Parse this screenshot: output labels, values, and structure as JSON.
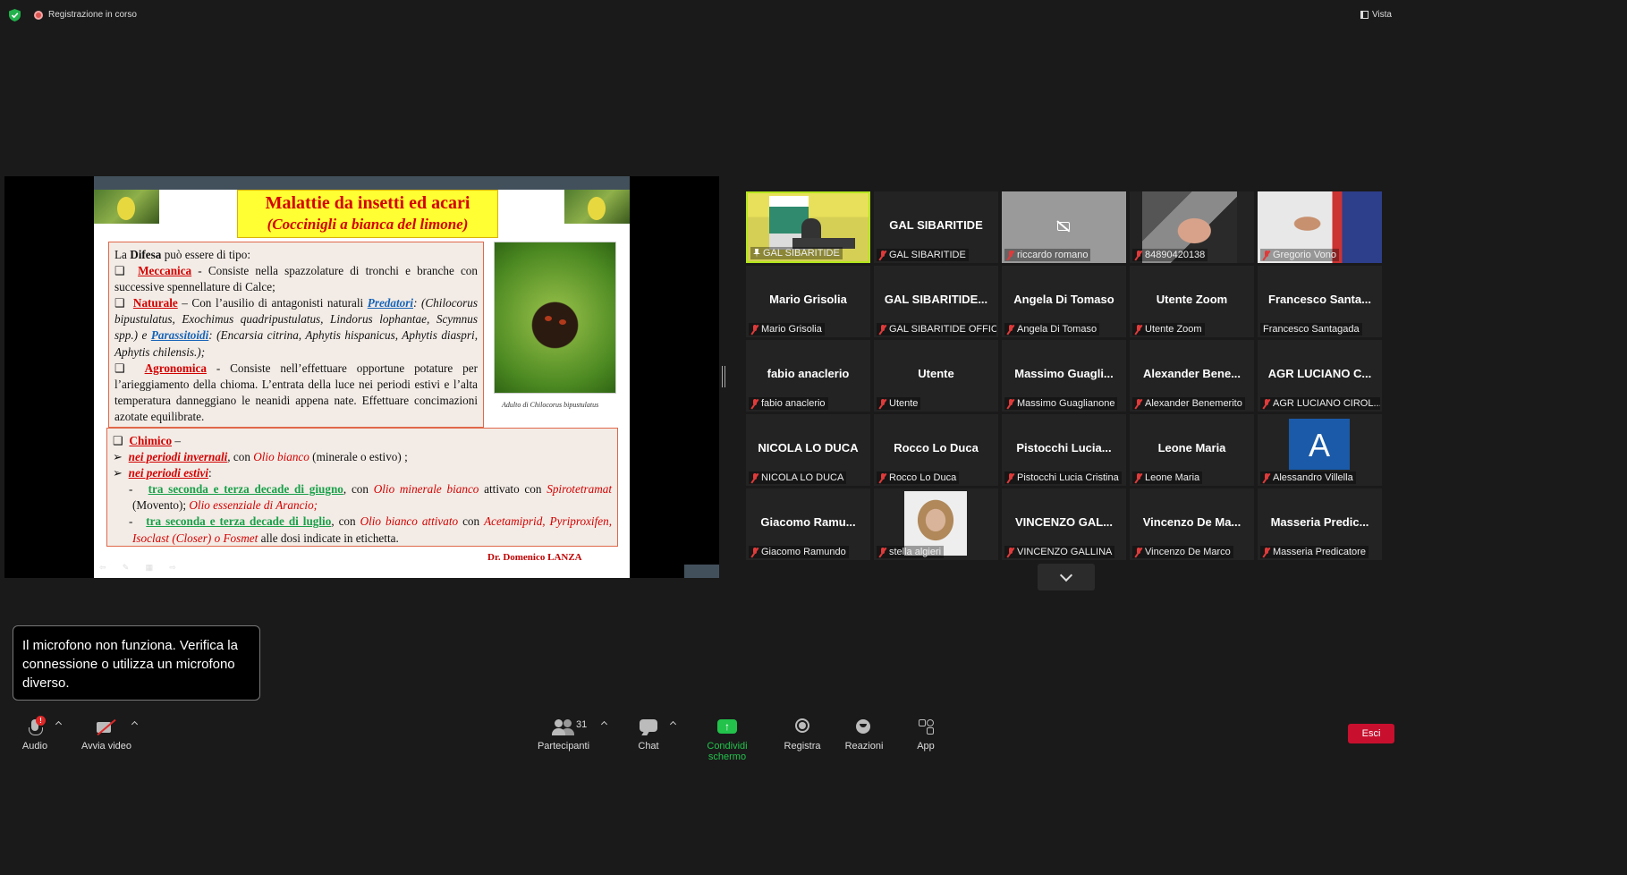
{
  "topbar": {
    "recording_label": "Registrazione in corso",
    "view_label": "Vista"
  },
  "slide": {
    "title": "Malattie da insetti ed acari",
    "subtitle": "(Coccinigli a bianca del limone)",
    "intro_pre": "La ",
    "intro_bold": "Difesa",
    "intro_post": " può essere di tipo:",
    "meccanica_label": "Meccanica",
    "meccanica_text": " - Consiste nella spazzolature di tronchi e branche con successive spennellature di Calce;",
    "naturale_label": "Naturale",
    "naturale_text1": " – Con l’ausilio di antagonisti naturali ",
    "predatori_label": "Predatori",
    "naturale_text2": ": (Chilocorus bipustulatus, Exochimus quadripustulatus, Lindorus lophantae, Scymnus spp.) e ",
    "parassitoidi_label": "Parassitoidi",
    "naturale_text3": ": (Encarsia citrina, Aphytis hispanicus, Aphytis diaspri, Aphytis chilensis.);",
    "agronomica_label": "Agronomica",
    "agronomica_text": " - Consiste nell’effettuare opportune potature per l’arieggiamento della chioma. L’entrata della luce nei periodi estivi e l’alta temperatura danneggiano le neanidi appena nate. Effettuare concimazioni azotate equilibrate.",
    "image_caption": "Adulto di Chilocorus bipustulatus",
    "chimico_label": "Chimico",
    "chimico_dash": " –",
    "invernali_label": "nei periodi invernali",
    "invernali_text1": ",  con ",
    "invernali_prod": "Olio bianco",
    "invernali_text2": " (minerale o estivo) ;",
    "estivi_label": "nei periodi estivi",
    "estivi_colon": ":",
    "giugno_label": "tra seconda e terza decade di giugno",
    "giugno_text1": ", con  ",
    "giugno_prod1": "Olio minerale bianco",
    "giugno_text2": " attivato con ",
    "giugno_prod2": "Spirotetramat",
    "giugno_text3": " (Movento); ",
    "giugno_prod3": "Olio essenziale di Arancio;",
    "luglio_label": "tra seconda e terza decade di luglio",
    "luglio_text1": ", con  ",
    "luglio_prod1": "Olio bianco attivato",
    "luglio_text2": " con ",
    "luglio_prod2": "Acetamiprid, Pyriproxifen, Isoclast (Closer) o Fosmet",
    "luglio_text3": "  alle dosi indicate in etichetta.",
    "author": "Dr. Domenico LANZA",
    "controls": "⇦ ✎ ▦ ⇨"
  },
  "participants": [
    {
      "name": "",
      "label": "GAL SIBARITIDE",
      "pinned": true,
      "active": true,
      "kind": "video-gal"
    },
    {
      "name": "GAL SIBARITIDE",
      "label": "GAL SIBARITIDE",
      "kind": "name"
    },
    {
      "name": "",
      "label": "riccardo romano",
      "kind": "cam-off"
    },
    {
      "name": "",
      "label": "84890420138",
      "kind": "video-man"
    },
    {
      "name": "",
      "label": "Gregorio Vono",
      "kind": "video-greg"
    },
    {
      "name": "Mario Grisolia",
      "label": "Mario Grisolia",
      "kind": "name"
    },
    {
      "name": "GAL SIBARITIDE...",
      "label": "GAL SIBARITIDE OFFICE",
      "kind": "name"
    },
    {
      "name": "Angela Di Tomaso",
      "label": "Angela Di Tomaso",
      "kind": "name"
    },
    {
      "name": "Utente Zoom",
      "label": "Utente Zoom",
      "kind": "name"
    },
    {
      "name": "Francesco  Santa...",
      "label": "Francesco Santagada",
      "kind": "name",
      "no_mic": true
    },
    {
      "name": "fabio anaclerio",
      "label": "fabio anaclerio",
      "kind": "name"
    },
    {
      "name": "Utente",
      "label": "Utente",
      "kind": "name"
    },
    {
      "name": "Massimo  Guagli...",
      "label": "Massimo Guaglianone",
      "kind": "name"
    },
    {
      "name": "Alexander  Bene...",
      "label": "Alexander Benemerito",
      "kind": "name"
    },
    {
      "name": "AGR LUCIANO C...",
      "label": "AGR LUCIANO CIROL...",
      "kind": "name"
    },
    {
      "name": "NICOLA LO DUCA",
      "label": "NICOLA LO DUCA",
      "kind": "name"
    },
    {
      "name": "Rocco Lo Duca",
      "label": "Rocco Lo Duca",
      "kind": "name"
    },
    {
      "name": "Pistocchi  Lucia...",
      "label": "Pistocchi Lucia Cristina",
      "kind": "name"
    },
    {
      "name": "Leone Maria",
      "label": "Leone Maria",
      "kind": "name"
    },
    {
      "name": "A",
      "label": "Alessandro Villella",
      "kind": "avatar"
    },
    {
      "name": "Giacomo  Ramu...",
      "label": "Giacomo Ramundo",
      "kind": "name"
    },
    {
      "name": "",
      "label": "stella algieri",
      "kind": "photo"
    },
    {
      "name": "VINCENZO  GAL...",
      "label": "VINCENZO GALLINA",
      "kind": "name"
    },
    {
      "name": "Vincenzo  De  Ma...",
      "label": "Vincenzo De Marco",
      "kind": "name"
    },
    {
      "name": "Masseria  Predic...",
      "label": "Masseria Predicatore",
      "kind": "name"
    }
  ],
  "toast": {
    "message": "Il microfono non funziona. Verifica la connessione o utilizza un microfono diverso."
  },
  "toolbar": {
    "audio_label": "Audio",
    "audio_badge": "!",
    "video_label": "Avvia video",
    "participants_label": "Partecipanti",
    "participants_count": "31",
    "chat_label": "Chat",
    "share_label": "Condividi schermo",
    "record_label": "Registra",
    "reactions_label": "Reazioni",
    "apps_label": "App",
    "exit_label": "Esci"
  },
  "colors": {
    "share_green": "#22c24b",
    "exit_red": "#c8102e",
    "active_border": "#b5e61d",
    "avatar_blue": "#1a5aa8"
  }
}
